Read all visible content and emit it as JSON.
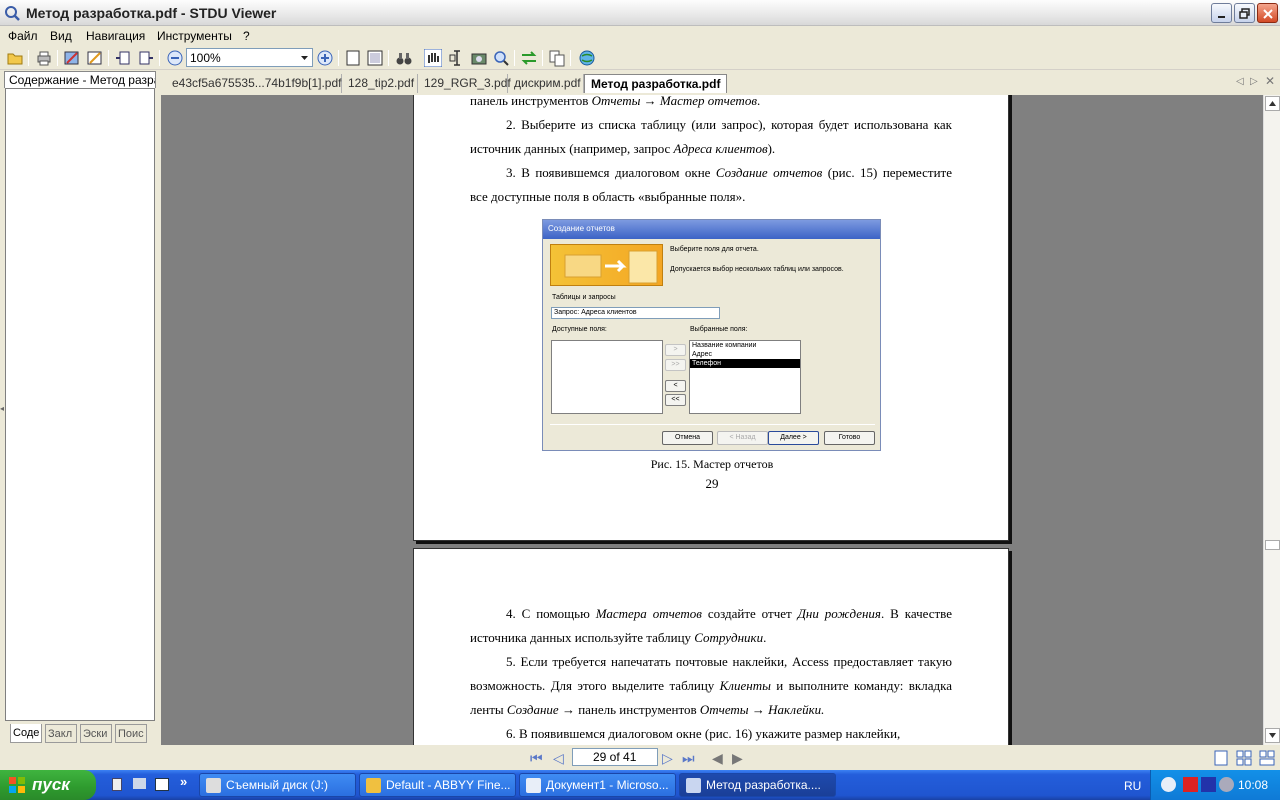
{
  "window": {
    "title": "Метод разработка.pdf - STDU Viewer"
  },
  "menu": [
    "Файл",
    "Вид",
    "Навигация",
    "Инструменты",
    "?"
  ],
  "toolbar": {
    "zoom_value": "100%"
  },
  "left_panel": {
    "tab_title": "Содержание - Метод разраб",
    "bottom_tabs": [
      "Соде",
      "Закл",
      "Эски",
      "Поис"
    ]
  },
  "doc_tabs": [
    "e43cf5a675535...74b1f9b[1].pdf",
    "128_tip2.pdf",
    "129_RGR_3.pdf",
    "дискрим.pdf",
    "Метод разработка.pdf"
  ],
  "page1": {
    "line0_a": "панель инструментов ",
    "line0_b": "Отчеты → Мастер отчетов",
    "line0_c": ".",
    "item2_a": "2.   Выберите из списка таблицу (или запрос), которая будет использована как источник данных (например, запрос ",
    "item2_b": "Адреса клиентов",
    "item2_c": ").",
    "item3_a": "3.   В появившемся диалоговом окне ",
    "item3_b": "Создание отчетов",
    "item3_c": " (рис. 15) переместите все доступные поля в область «выбранные поля».",
    "caption": "Рис. 15. Мастер отчетов",
    "page_number": "29"
  },
  "dialog": {
    "title": "Создание отчетов",
    "prompt1": "Выберите поля для отчета.",
    "prompt2": "Допускается выбор нескольких таблиц или запросов.",
    "tables_label": "Таблицы и запросы",
    "combo_value": "Запрос: Адреса клиентов",
    "available_label": "Доступные поля:",
    "selected_label": "Выбранные поля:",
    "selected_items": [
      "Название компании",
      "Адрес",
      "Телефон"
    ],
    "btn_add": ">",
    "btn_add_all": ">>",
    "btn_remove": "<",
    "btn_remove_all": "<<",
    "btn_cancel": "Отмена",
    "btn_back": "< Назад",
    "btn_next": "Далее >",
    "btn_finish": "Готово"
  },
  "page2": {
    "item4_a": "4.   С помощью ",
    "item4_b": "Мастера отчетов",
    "item4_c": " создайте отчет ",
    "item4_d": "Дни рождения",
    "item4_e": ". В качестве источника данных используйте таблицу ",
    "item4_f": "Сотрудники",
    "item4_g": ".",
    "item5_a": "5.   Если требуется напечатать почтовые наклейки, Access предоставляет такую возможность. Для этого выделите таблицу ",
    "item5_b": "Клиенты",
    "item5_c": " и выполните команду: вкладка ленты ",
    "item5_d": "Создание",
    "item5_e": " → панель инструментов ",
    "item5_f": "Отчеты → Наклейки.",
    "item6": "6.   В появившемся диалоговом окне (рис. 16) укажите размер наклейки,"
  },
  "status": {
    "page_indicator": "29 of 41"
  },
  "taskbar": {
    "start_label": "пуск",
    "tasks": [
      "Съемный диск (J:)",
      "Default - ABBYY Fine...",
      "Документ1 - Microso...",
      "Метод разработка...."
    ],
    "language": "RU",
    "clock": "10:08"
  },
  "colors": {
    "viewer_bg": "#808080",
    "chrome": "#ece9d8",
    "taskbar": "#245edb"
  }
}
